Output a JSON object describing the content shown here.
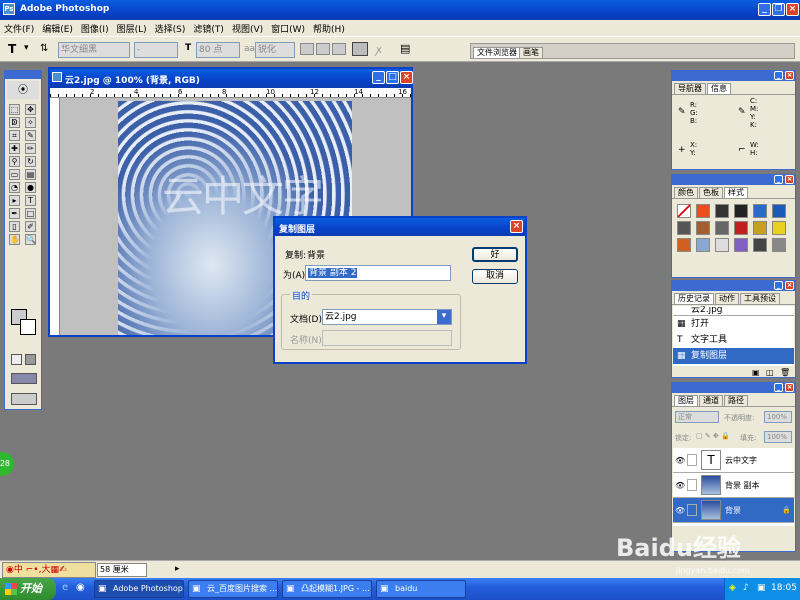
{
  "app": {
    "title": "Adobe Photoshop"
  },
  "menu": [
    "文件(F)",
    "编辑(E)",
    "图像(I)",
    "图层(L)",
    "选择(S)",
    "滤镜(T)",
    "视图(V)",
    "窗口(W)",
    "帮助(H)"
  ],
  "options": {
    "font_family": "华文细黑",
    "font_style": "-",
    "font_size": "80 点",
    "aa_label": "aa",
    "aa_value": "锐化",
    "file_browser_tab": "文件浏览器",
    "brushes_tab": "画笔"
  },
  "document": {
    "title": "云2.jpg @ 100% (背景, RGB)",
    "overlay_text": "云中文字",
    "ruler_labels": [
      "2",
      "4",
      "6",
      "8",
      "10",
      "12",
      "14",
      "16"
    ]
  },
  "dialog": {
    "title": "复制图层",
    "copy_label": "复制:",
    "copy_value": "背景",
    "as_label": "为(A):",
    "as_value": "背景 副本 2",
    "dest_group": "目的",
    "doc_label": "文档(D):",
    "doc_value": "云2.jpg",
    "name_label": "名称(N):",
    "ok": "好",
    "cancel": "取消"
  },
  "navigator": {
    "tabs": [
      "导航器",
      "信息"
    ],
    "rgb": [
      "R:",
      "G:",
      "B:"
    ],
    "cmyk": [
      "C:",
      "M:",
      "Y:",
      "K:"
    ],
    "xy": [
      "X:",
      "Y:"
    ],
    "wh": [
      "W:",
      "H:"
    ]
  },
  "styles_panel": {
    "tabs": [
      "颜色",
      "色板",
      "样式"
    ]
  },
  "history": {
    "tabs": [
      "历史记录",
      "动作",
      "工具预设"
    ],
    "snapshot": "云2.jpg",
    "items": [
      "打开",
      "文字工具",
      "复制图层"
    ]
  },
  "layers": {
    "tabs": [
      "图层",
      "通道",
      "路径"
    ],
    "blend": "正常",
    "opacity_label": "不透明度:",
    "opacity": "100%",
    "lock_label": "锁定:",
    "fill_label": "填充:",
    "fill": "100%",
    "items": [
      "云中文字",
      "背景 副本",
      "背景"
    ]
  },
  "status": {
    "zoom": "58 厘米",
    "ime": "中"
  },
  "taskbar": {
    "start": "开始",
    "items": [
      "Adobe Photoshop",
      "云_百度图片搜索 ...",
      "凸起模糊1.JPG - ...",
      "baidu"
    ],
    "clock": "18:05"
  },
  "watermark": {
    "brand": "Baidu经验",
    "url": "jingyan.baidu.com"
  },
  "badge": "28",
  "colors": {
    "xp_blue": "#0842c8",
    "desktop": "#7a7a7a",
    "selection": "#316ac5"
  }
}
